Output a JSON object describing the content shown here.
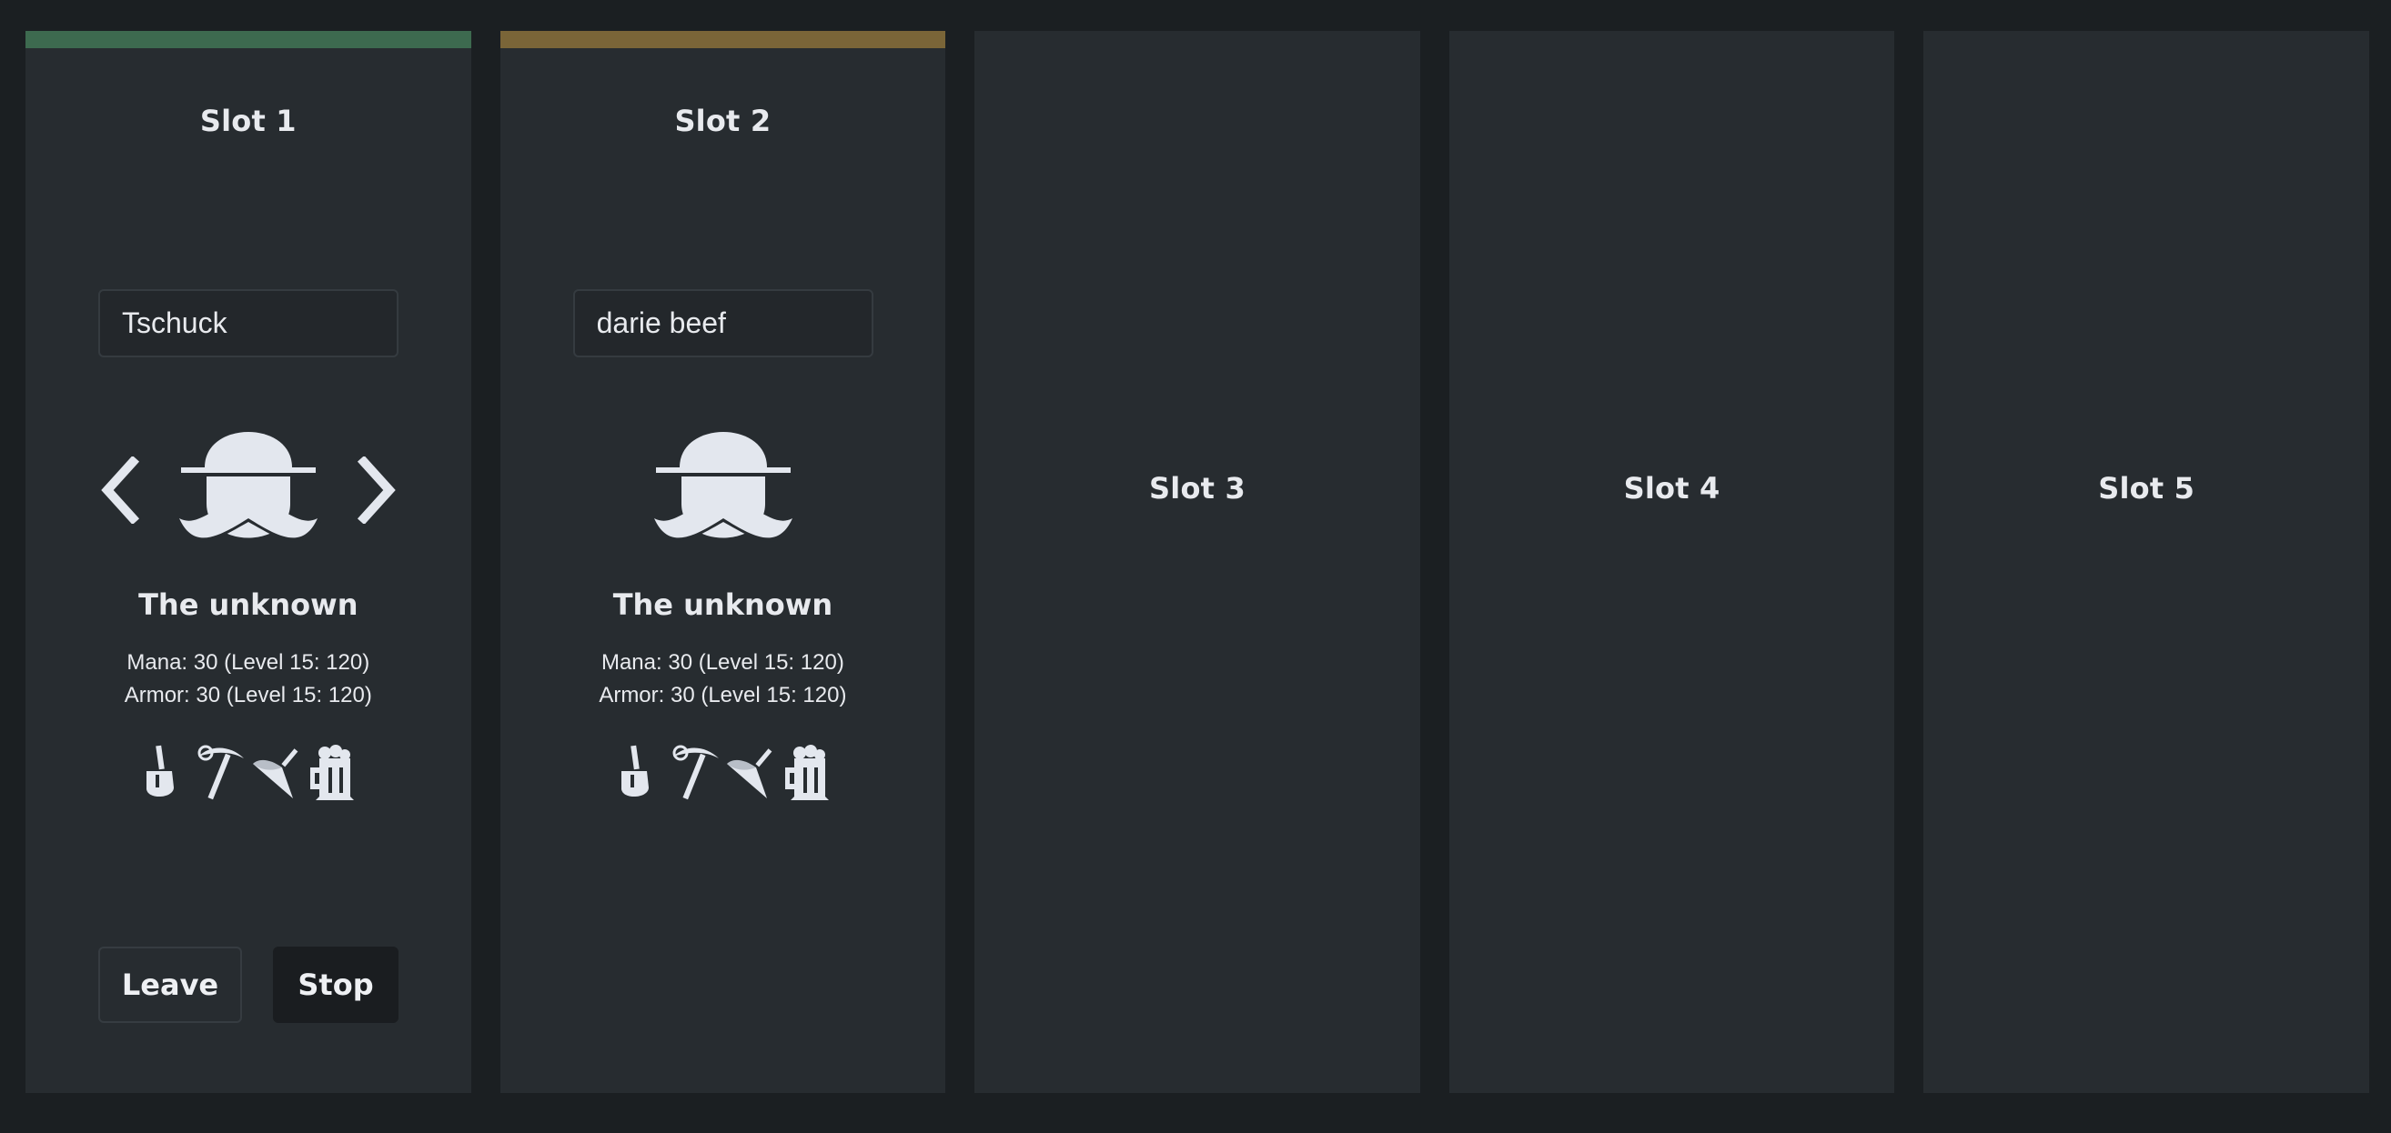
{
  "colors": {
    "background": "#1b1f22",
    "panel": "#272c30",
    "slot1_bar": "#3d6a4f",
    "slot2_bar": "#7a6538",
    "text": "#e8eaee"
  },
  "slots": [
    {
      "title": "Slot 1",
      "name_value": "Tschuck",
      "class_name": "The unknown",
      "mana": "Mana: 30 (Level 15: 120)",
      "armor": "Armor: 30 (Level 15: 120)",
      "avatar_icon": "bowler-hat-mustache-icon",
      "tools": [
        "shovel-icon",
        "pickaxe-icon",
        "spinning-top-icon",
        "beer-mug-icon"
      ],
      "leave_label": "Leave",
      "stop_label": "Stop"
    },
    {
      "title": "Slot 2",
      "name_value": "darie beef",
      "class_name": "The unknown",
      "mana": "Mana: 30 (Level 15: 120)",
      "armor": "Armor: 30 (Level 15: 120)",
      "avatar_icon": "bowler-hat-mustache-icon",
      "tools": [
        "shovel-icon",
        "pickaxe-icon",
        "spinning-top-icon",
        "beer-mug-icon"
      ]
    },
    {
      "title": "Slot 3"
    },
    {
      "title": "Slot 4"
    },
    {
      "title": "Slot 5"
    }
  ]
}
